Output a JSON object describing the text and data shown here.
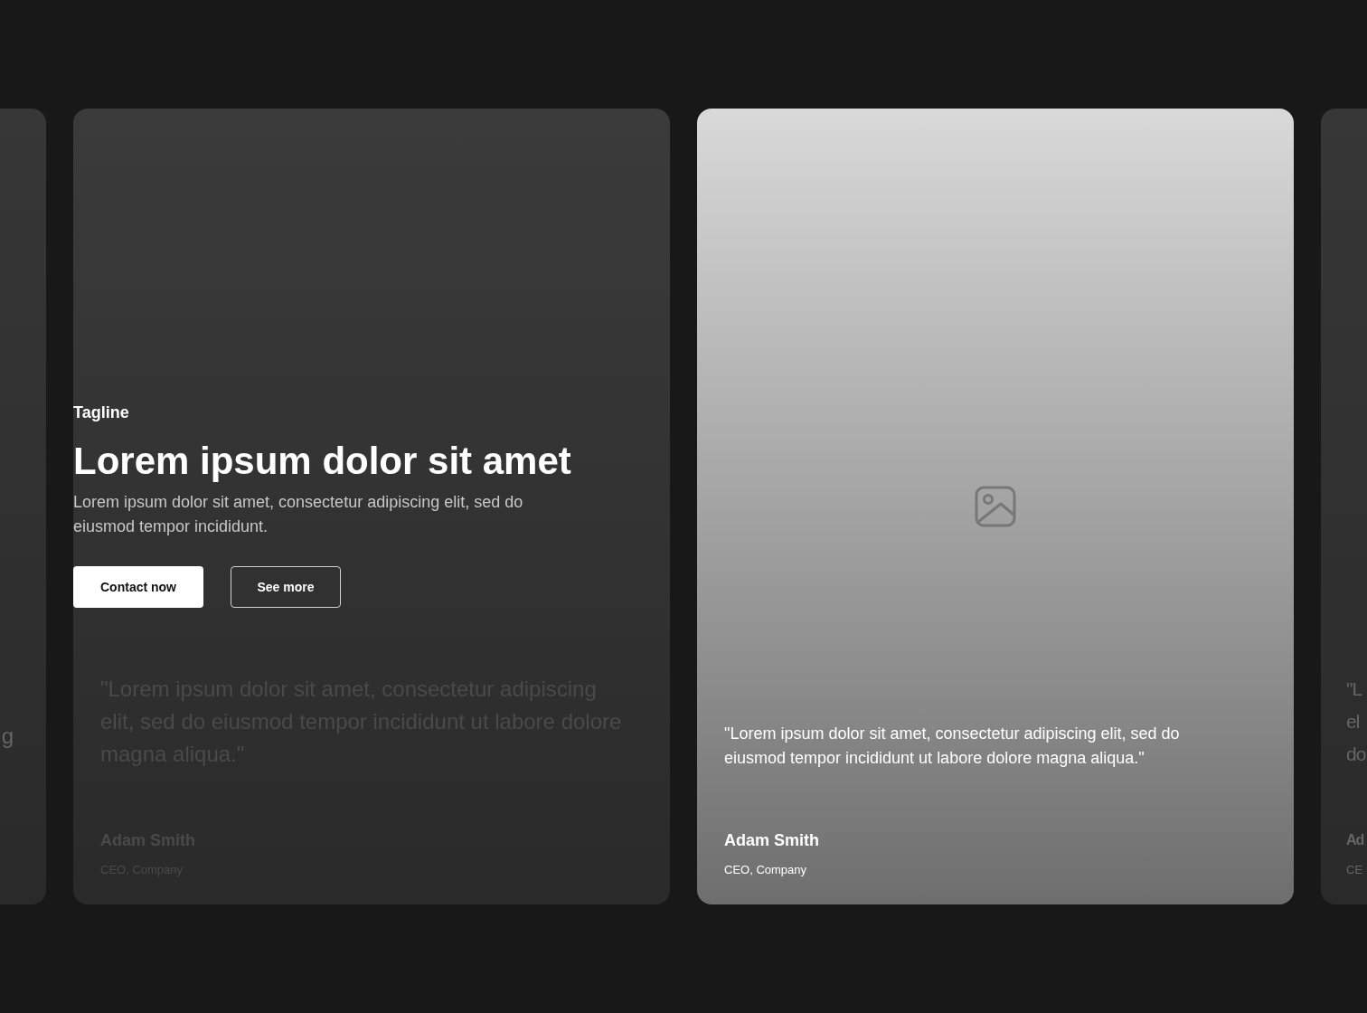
{
  "cards": [
    {
      "kind": "partial-left",
      "quote_lines": [
        "g"
      ]
    },
    {
      "kind": "full",
      "selected": false,
      "quote": "\"Lorem ipsum dolor sit amet, consectetur adipiscing elit, sed do eiusmod tempor incididunt ut labore dolore magna aliqua.\"",
      "name": "Adam Smith",
      "role": "CEO, Company"
    },
    {
      "kind": "full",
      "selected": true,
      "quote": "\"Lorem ipsum dolor sit amet, consectetur adipiscing elit, sed do eiusmod tempor incididunt ut labore dolore magna aliqua.\"",
      "name": "Adam Smith",
      "role": "CEO, Company"
    },
    {
      "kind": "partial-right",
      "quote_lines": [
        "\"L",
        "el",
        "do"
      ],
      "name": "Ad",
      "role": "CE"
    }
  ],
  "hero": {
    "tagline": "Tagline",
    "heading": "Lorem ipsum dolor sit amet",
    "body": "Lorem ipsum dolor sit amet, consectetur adipiscing elit, sed do eiusmod tempor incididunt.",
    "buttons": [
      {
        "label": "Contact now",
        "kind": "primary"
      },
      {
        "label": "See more",
        "kind": "secondary"
      }
    ]
  }
}
